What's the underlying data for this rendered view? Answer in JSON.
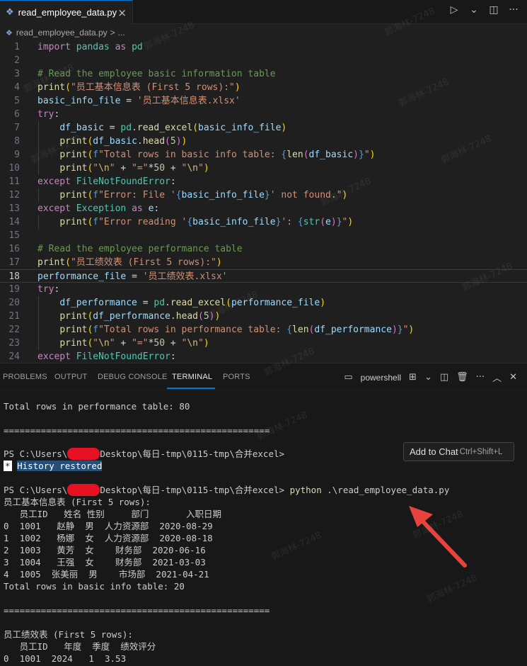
{
  "tab": {
    "icon": "python-file-icon",
    "label": "read_employee_data.py",
    "close": "×"
  },
  "titlebar_actions": {
    "run": "▷",
    "run_menu": "⌄",
    "split": "◫",
    "more": "···"
  },
  "breadcrumb": {
    "file": "read_employee_data.py",
    "sep": ">",
    "more": "..."
  },
  "editor": {
    "current_line": 18,
    "lines": [
      {
        "n": "1"
      },
      {
        "n": "2"
      },
      {
        "n": "3"
      },
      {
        "n": "4"
      },
      {
        "n": "5"
      },
      {
        "n": "6"
      },
      {
        "n": "7"
      },
      {
        "n": "8"
      },
      {
        "n": "9"
      },
      {
        "n": "10"
      },
      {
        "n": "11"
      },
      {
        "n": "12"
      },
      {
        "n": "13"
      },
      {
        "n": "14"
      },
      {
        "n": "15"
      },
      {
        "n": "16"
      },
      {
        "n": "17"
      },
      {
        "n": "18"
      },
      {
        "n": "19"
      },
      {
        "n": "20"
      },
      {
        "n": "21"
      },
      {
        "n": "22"
      },
      {
        "n": "23"
      },
      {
        "n": "24"
      }
    ]
  },
  "panel": {
    "tabs": [
      "PROBLEMS",
      "OUTPUT",
      "DEBUG CONSOLE",
      "TERMINAL",
      "PORTS"
    ],
    "active_tab": "TERMINAL",
    "shell": "powershell"
  },
  "terminal": {
    "lines": [
      "Total rows in performance table: 80",
      "",
      "==================================================",
      "",
      "PS C:\\Users\\",
      "",
      "",
      "PS C:\\Users\\",
      "员工基本信息表 (First 5 rows):",
      "   员工ID   姓名 性别     部门       入职日期",
      "0  1001   赵静  男  人力资源部  2020-08-29",
      "1  1002   杨娜  女  人力资源部  2020-08-18",
      "2  1003   黄芳  女    财务部  2020-06-16",
      "3  1004   王强  女    财务部  2021-03-03",
      "4  1005  张美丽  男    市场部  2021-04-21",
      "Total rows in basic info table: 20",
      "",
      "==================================================",
      "",
      "员工绩效表 (First 5 rows):",
      "   员工ID   年度  季度  绩效评分",
      "0  1001  2024   1  3.53"
    ],
    "prompt_path_1": "Desktop\\每日-tmp\\0115-tmp\\合并excel>",
    "prompt_path_2": "Desktop\\每日-tmp\\0115-tmp\\合并excel>",
    "history_star": "*",
    "history_text": "History restored",
    "command_python": "python",
    "command_arg": ".\\read_employee_data.py"
  },
  "tooltip": {
    "label": "Add to Chat",
    "shortcut": "Ctrl+Shift+L"
  },
  "watermark": "郭海林-7248",
  "colors": {
    "accent": "#0078d4",
    "annotation_arrow": "#e8423c",
    "redaction": "#e81123"
  }
}
